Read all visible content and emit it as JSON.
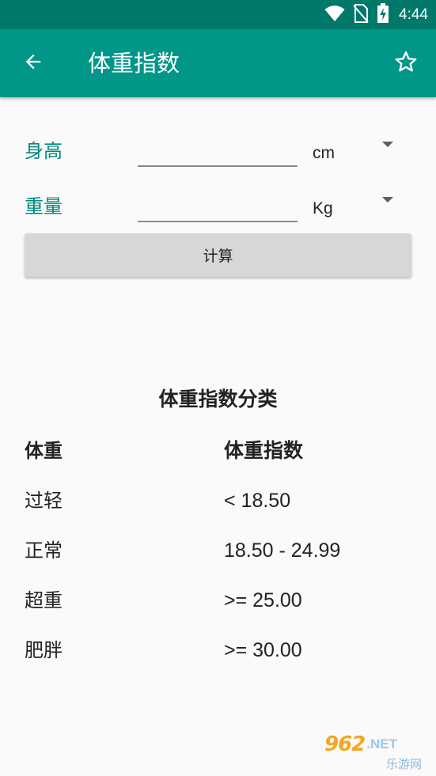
{
  "status_bar": {
    "time": "4:44",
    "colors": {
      "background": "#00796b"
    },
    "icons": [
      "wifi-icon",
      "no-sim-icon",
      "battery-charging-icon"
    ]
  },
  "toolbar": {
    "title": "体重指数",
    "back_icon": "arrow-back-icon",
    "favorite_icon": "star-outline-icon",
    "colors": {
      "background": "#009688",
      "text": "#ffffff"
    }
  },
  "form": {
    "height": {
      "label": "身高",
      "value": "",
      "unit": "cm"
    },
    "weight": {
      "label": "重量",
      "value": "",
      "unit": "Kg"
    },
    "label_color": "#00897b",
    "calculate_label": "计算"
  },
  "bmi_table": {
    "title": "体重指数分类",
    "headers": [
      "体重",
      "体重指数"
    ],
    "rows": [
      [
        "过轻",
        "< 18.50"
      ],
      [
        "正常",
        "18.50 - 24.99"
      ],
      [
        "超重",
        ">= 25.00"
      ],
      [
        "肥胖",
        ">= 30.00"
      ]
    ]
  },
  "watermark": {
    "logo_number": "962",
    "logo_suffix": ".NET",
    "logo_sub": "乐游网"
  }
}
